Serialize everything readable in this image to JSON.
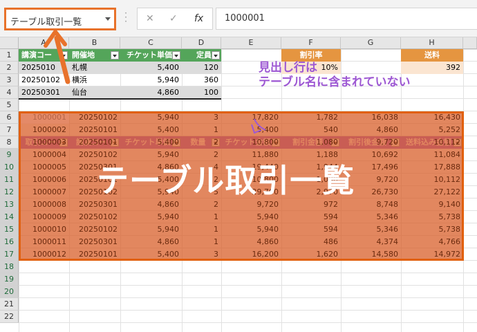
{
  "formula_bar": {
    "name_box_value": "テーブル取引一覧",
    "formula_value": "1000001",
    "cancel_icon": "✕",
    "enter_icon": "✓",
    "fx_label": "fx"
  },
  "columns": [
    "A",
    "B",
    "C",
    "D",
    "E",
    "F",
    "G",
    "H"
  ],
  "rows": [
    "1",
    "2",
    "3",
    "4",
    "5",
    "6",
    "7",
    "8",
    "9",
    "10",
    "11",
    "12",
    "13",
    "14",
    "15",
    "16",
    "17",
    "18",
    "19",
    "20",
    "21",
    "22"
  ],
  "table1": {
    "headers": [
      "講演コー",
      "開催地",
      "チケット単価",
      "定員"
    ],
    "rows": [
      [
        "2025010",
        "札幌",
        "5,400",
        "120"
      ],
      [
        "20250102",
        "横浜",
        "5,940",
        "360"
      ],
      [
        "20250301",
        "仙台",
        "4,860",
        "100"
      ]
    ]
  },
  "side": {
    "discount_label": "割引率",
    "discount_value": "10%",
    "shipping_label": "送料",
    "shipping_value": "392"
  },
  "table2": {
    "headers": [
      "取引コー",
      "講演コー",
      "チケット単価",
      "数量",
      "チケット金額",
      "割引金額",
      "割引後金額",
      "送料込み金額"
    ],
    "rows": [
      [
        "1000001",
        "20250102",
        "5,940",
        "3",
        "17,820",
        "1,782",
        "16,038",
        "16,430"
      ],
      [
        "1000002",
        "20250101",
        "5,400",
        "1",
        "5,400",
        "540",
        "4,860",
        "5,252"
      ],
      [
        "1000003",
        "20250101",
        "5,400",
        "2",
        "10,800",
        "1,080",
        "9,720",
        "10,112"
      ],
      [
        "1000004",
        "20250102",
        "5,940",
        "2",
        "11,880",
        "1,188",
        "10,692",
        "11,084"
      ],
      [
        "1000005",
        "20250301",
        "4,860",
        "4",
        "19,440",
        "1,944",
        "17,496",
        "17,888"
      ],
      [
        "1000006",
        "20250101",
        "5,400",
        "2",
        "10,800",
        "1,080",
        "9,720",
        "10,112"
      ],
      [
        "1000007",
        "20250102",
        "5,940",
        "5",
        "29,700",
        "2,970",
        "26,730",
        "27,122"
      ],
      [
        "1000008",
        "20250301",
        "4,860",
        "2",
        "9,720",
        "972",
        "8,748",
        "9,140"
      ],
      [
        "1000009",
        "20250102",
        "5,940",
        "1",
        "5,940",
        "594",
        "5,346",
        "5,738"
      ],
      [
        "1000010",
        "20250102",
        "5,940",
        "1",
        "5,940",
        "594",
        "5,346",
        "5,738"
      ],
      [
        "1000011",
        "20250301",
        "4,860",
        "1",
        "4,860",
        "486",
        "4,374",
        "4,766"
      ],
      [
        "1000012",
        "20250101",
        "5,400",
        "3",
        "16,200",
        "1,620",
        "14,580",
        "14,972"
      ]
    ]
  },
  "annotations": {
    "callout_line1": "見出し行は",
    "callout_line2": "テーブル名に含まれていない",
    "big_label": "テーブル取引一覧"
  },
  "colors": {
    "table1_header": "#54a55a",
    "table2_header": "#9d58d3",
    "side_header": "#e59540",
    "highlight": "#e1600e"
  }
}
